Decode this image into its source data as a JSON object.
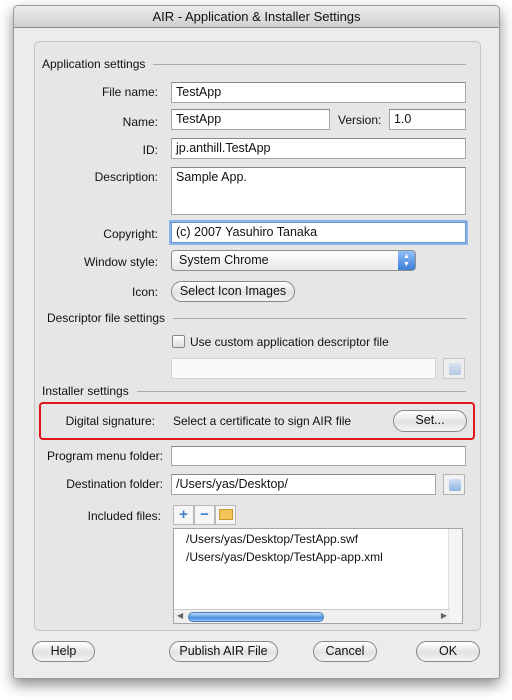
{
  "window": {
    "title": "AIR - Application & Installer Settings"
  },
  "application_settings": {
    "header": "Application settings",
    "file_name": {
      "label": "File name:",
      "value": "TestApp"
    },
    "name": {
      "label": "Name:",
      "value": "TestApp"
    },
    "version": {
      "label": "Version:",
      "value": "1.0"
    },
    "id": {
      "label": "ID:",
      "value": "jp.anthill.TestApp"
    },
    "description": {
      "label": "Description:",
      "value": "Sample App."
    },
    "copyright": {
      "label": "Copyright:",
      "value": "(c) 2007 Yasuhiro Tanaka"
    },
    "window_style": {
      "label": "Window style:",
      "value": "System Chrome"
    },
    "icon": {
      "label": "Icon:",
      "button": "Select Icon Images"
    }
  },
  "descriptor_settings": {
    "header": "Descriptor file settings",
    "checkbox_label": "Use custom application descriptor file",
    "checked": false,
    "path": ""
  },
  "installer_settings": {
    "header": "Installer settings",
    "digital_signature": {
      "label": "Digital signature:",
      "text": "Select a certificate to sign AIR file",
      "button": "Set..."
    },
    "program_menu_folder": {
      "label": "Program menu folder:",
      "value": ""
    },
    "destination_folder": {
      "label": "Destination folder:",
      "value": "/Users/yas/Desktop/"
    },
    "included_files": {
      "label": "Included files:",
      "files": [
        "/Users/yas/Desktop/TestApp.swf",
        "/Users/yas/Desktop/TestApp-app.xml"
      ],
      "scroll_fraction": 0.55
    }
  },
  "footer": {
    "help": "Help",
    "publish": "Publish AIR File",
    "cancel": "Cancel",
    "ok": "OK"
  },
  "colors": {
    "highlight": "#e0161a",
    "accent": "#3b7ed8"
  }
}
